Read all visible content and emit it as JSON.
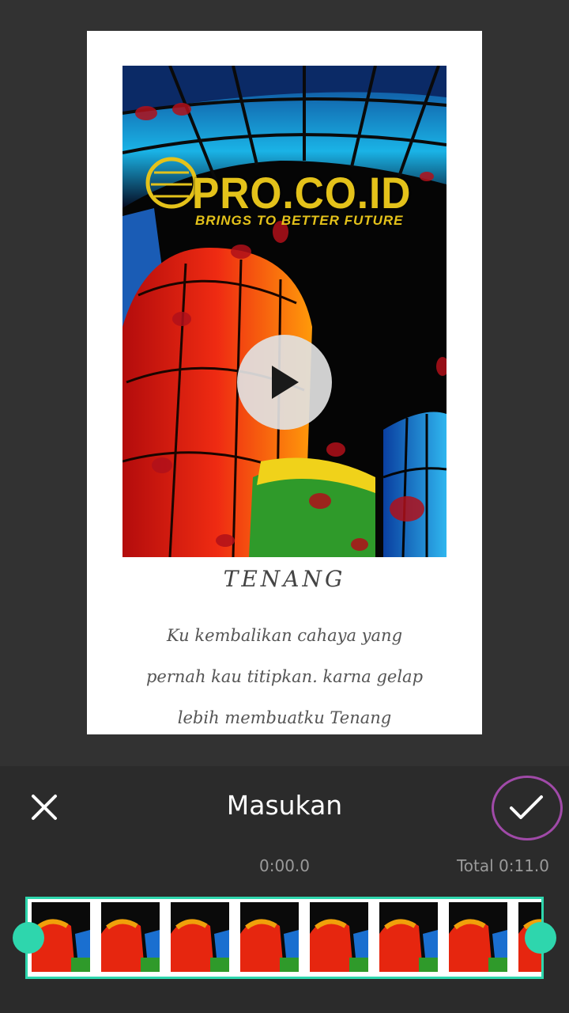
{
  "editor": {
    "title": "Masukan",
    "time_current": "0:00.0",
    "time_total": "Total 0:11.0"
  },
  "preview": {
    "logo_main": "PRO.CO.ID",
    "logo_tagline": "BRINGS TO BETTER FUTURE",
    "caption_title": "TENANG",
    "caption_lines": [
      "Ku kembalikan cahaya yang",
      "pernah kau titipkan. karna gelap",
      "lebih membuatku Tenang"
    ]
  },
  "icons": {
    "close": "close-icon",
    "confirm": "check-icon",
    "play": "play-icon"
  },
  "colors": {
    "accent": "#2ed6ad",
    "confirm_ring": "#a04aa8",
    "toolbar_bg": "#2b2b2b",
    "background": "#323232"
  },
  "timeline": {
    "thumbnail_count": 8
  }
}
